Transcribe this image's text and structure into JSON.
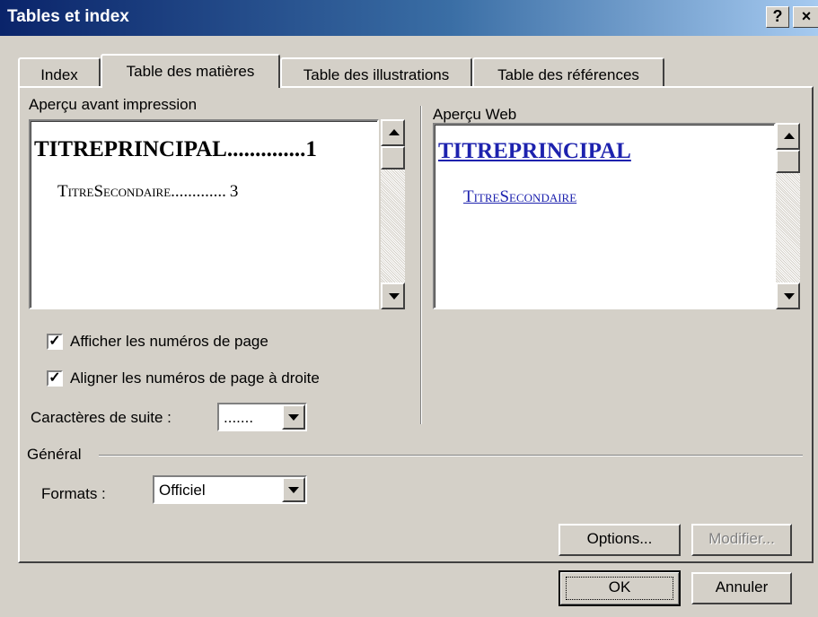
{
  "window": {
    "title": "Tables et index",
    "help_label": "?",
    "close_label": "×"
  },
  "tabs": [
    {
      "label": "Index",
      "active": false
    },
    {
      "label": "Table des matières",
      "active": true
    },
    {
      "label": "Table des illustrations",
      "active": false
    },
    {
      "label": "Table des références",
      "active": false
    }
  ],
  "print_preview": {
    "label": "Aperçu avant impression",
    "heading1": "TITREPRINCIPAL",
    "heading1_leader": "..............",
    "heading1_page": "1",
    "heading2": "TitreSecondaire",
    "heading2_leader": ".............",
    "heading2_page": "3"
  },
  "web_preview": {
    "label": "Aperçu Web",
    "heading1": "TITREPRINCIPAL",
    "heading2": "TitreSecondaire"
  },
  "options": {
    "show_page_numbers": {
      "label": "Afficher les numéros de page",
      "checked": true
    },
    "right_align_page_numbers": {
      "label": "Aligner les numéros de page à droite",
      "checked": true
    },
    "tab_leader": {
      "label": "Caractères de suite :",
      "value": "......."
    }
  },
  "general": {
    "label": "Général",
    "formats": {
      "label": "Formats :",
      "value": "Officiel"
    }
  },
  "buttons": {
    "options": "Options...",
    "modify": "Modifier...",
    "ok": "OK",
    "cancel": "Annuler"
  },
  "colors": {
    "titlebar_start": "#0a246a",
    "titlebar_end": "#a6caf0",
    "link": "#1d22ae",
    "face": "#d4d0c8"
  },
  "icons": {
    "help": "help-icon",
    "close": "close-icon",
    "check": "check-icon",
    "dropdown": "chevron-down-icon"
  }
}
